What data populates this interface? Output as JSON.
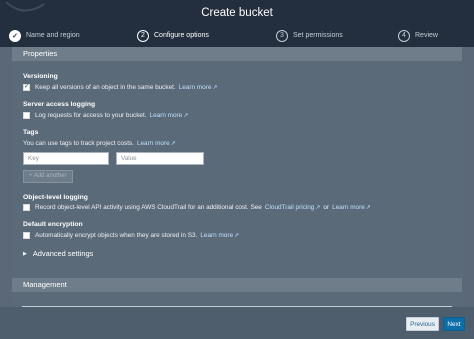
{
  "header": {
    "title": "Create bucket"
  },
  "steps": [
    {
      "number": "✓",
      "label": "Name and region"
    },
    {
      "number": "2",
      "label": "Configure options"
    },
    {
      "number": "3",
      "label": "Set permissions"
    },
    {
      "number": "4",
      "label": "Review"
    }
  ],
  "properties": {
    "heading": "Properties",
    "versioning": {
      "title": "Versioning",
      "text": "Keep all versions of an object in the same bucket.",
      "link": "Learn more",
      "checked": true
    },
    "access_logging": {
      "title": "Server access logging",
      "text": "Log requests for access to your bucket.",
      "link": "Learn more"
    },
    "tags": {
      "title": "Tags",
      "text": "You can use tags to track project costs.",
      "link": "Learn more",
      "key_placeholder": "Key",
      "value_placeholder": "Value",
      "add_label": "+ Add another"
    },
    "object_logging": {
      "title": "Object-level logging",
      "text": "Record object-level API activity using AWS CloudTrail for an additional cost. See",
      "link1": "CloudTrail pricing",
      "or": "or",
      "link2": "Learn more"
    },
    "encryption": {
      "title": "Default encryption",
      "text": "Automatically encrypt objects when they are stored in S3.",
      "link": "Learn more"
    },
    "advanced": "Advanced settings"
  },
  "management": {
    "heading": "Management"
  },
  "footer": {
    "previous": "Previous",
    "next": "Next"
  },
  "icons": {
    "check": "check-icon",
    "external": "external-link-icon",
    "caret": "caret-right-icon"
  },
  "colors": {
    "header_bg": "#232f3e",
    "primary_button": "#0d6ea8",
    "link": "#bfe0ff"
  }
}
